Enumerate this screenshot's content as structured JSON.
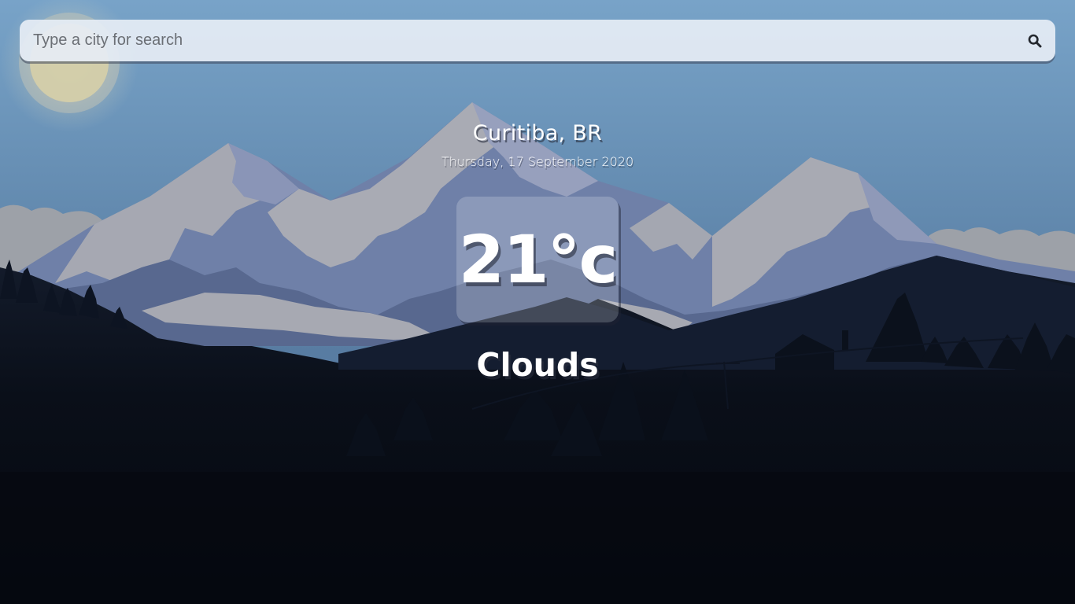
{
  "search": {
    "placeholder": "Type a city for search",
    "value": "",
    "icon": "search-icon"
  },
  "weather": {
    "location": "Curitiba, BR",
    "date": "Thursday, 17 September 2020",
    "temperature": "21°c",
    "condition": "Clouds"
  },
  "colors": {
    "sky_top": "#78a3c8",
    "sky_bottom": "#5b7fa3",
    "snow": "#a8acb6",
    "rock": "#5d6f97",
    "ground_dark": "#060b14",
    "text": "#ffffff"
  }
}
